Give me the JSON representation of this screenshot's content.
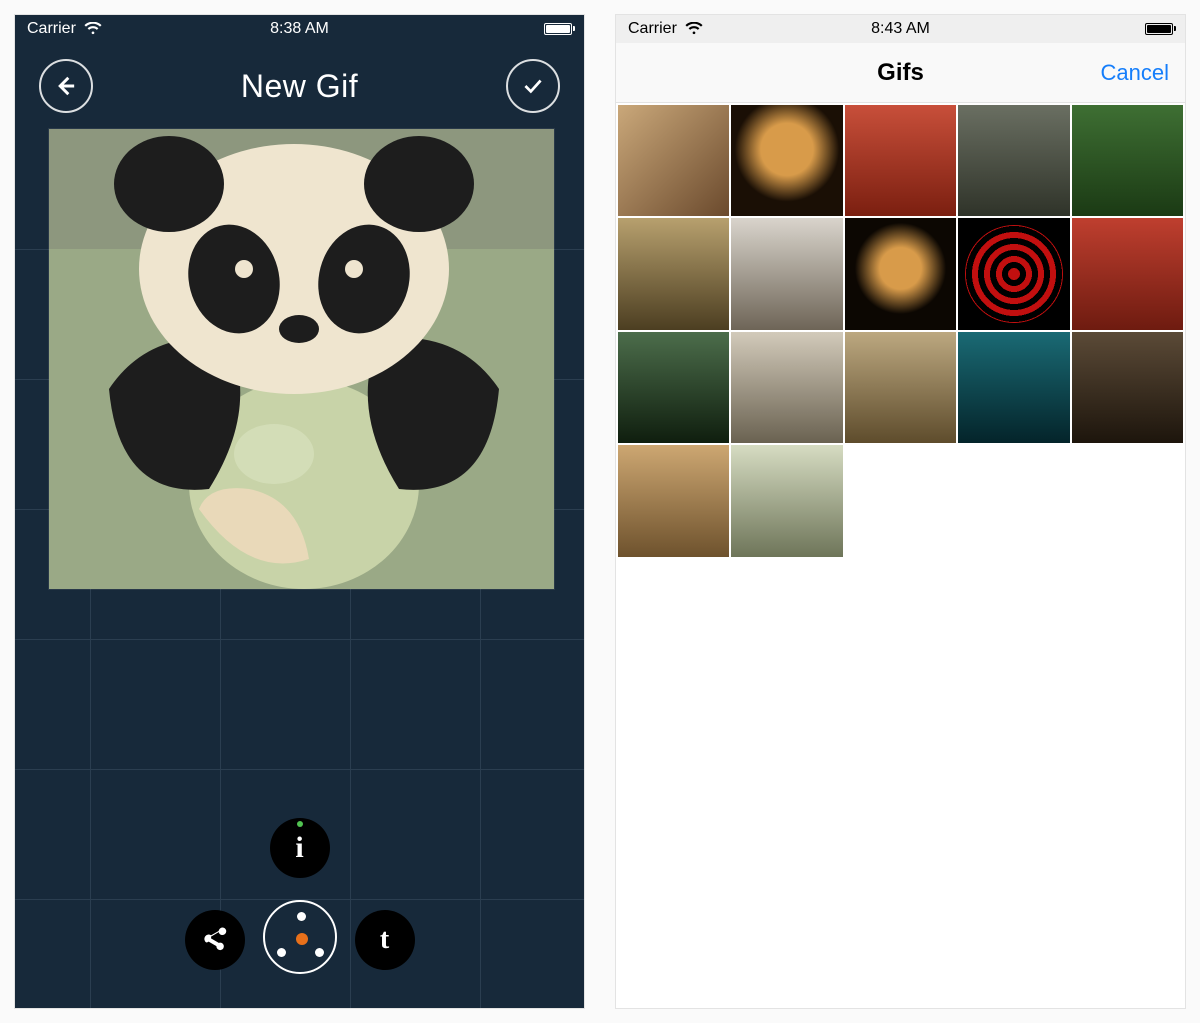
{
  "left": {
    "status": {
      "carrier": "Carrier",
      "time": "8:38 AM"
    },
    "header": {
      "back_name": "back-button",
      "confirm_name": "confirm-button",
      "title": "New Gif"
    },
    "radial": {
      "info_label": "i",
      "tumblr_label": "t"
    }
  },
  "right": {
    "status": {
      "carrier": "Carrier",
      "time": "8:43 AM"
    },
    "nav": {
      "title": "Gifs",
      "action": "Cancel"
    },
    "grid": {
      "count": 17
    }
  }
}
